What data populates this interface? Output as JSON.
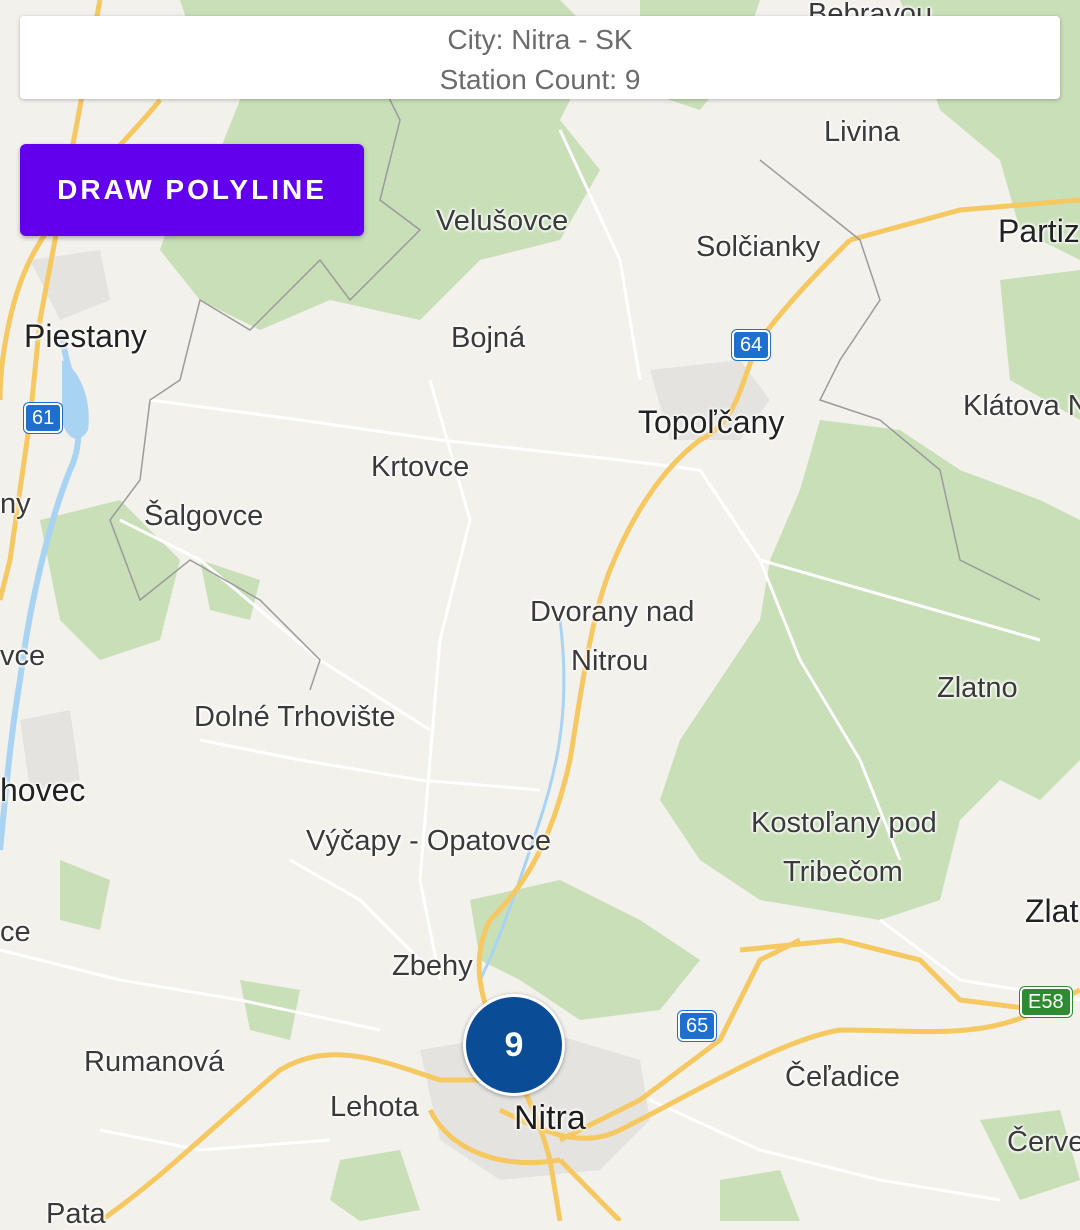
{
  "info_card": {
    "city_line": "City: Nitra - SK",
    "station_line": "Station Count: 9"
  },
  "toolbar": {
    "draw_polyline_label": "DRAW POLYLINE"
  },
  "cluster": {
    "count": "9",
    "color": "#0a4c95"
  },
  "map": {
    "places": [
      {
        "id": "bebravou",
        "name": "Bebravou"
      },
      {
        "id": "livina",
        "name": "Livina"
      },
      {
        "id": "velusovce",
        "name": "Velušovce"
      },
      {
        "id": "solcianky",
        "name": "Solčianky"
      },
      {
        "id": "partiz",
        "name": "Partiz"
      },
      {
        "id": "piestany",
        "name": "Piestany"
      },
      {
        "id": "bojna",
        "name": "Bojná"
      },
      {
        "id": "topolcany",
        "name": "Topoľčany"
      },
      {
        "id": "klatova",
        "name": "Klátova N"
      },
      {
        "id": "krtovce",
        "name": "Krtovce"
      },
      {
        "id": "ny",
        "name": "ny"
      },
      {
        "id": "salgovce",
        "name": "Šalgovce"
      },
      {
        "id": "dvorany1",
        "name": "Dvorany nad"
      },
      {
        "id": "dvorany2",
        "name": "Nitrou"
      },
      {
        "id": "vce",
        "name": "vce"
      },
      {
        "id": "zlatno",
        "name": "Zlatno"
      },
      {
        "id": "dolne",
        "name": "Dolné Trhovište"
      },
      {
        "id": "hovec",
        "name": "hovec"
      },
      {
        "id": "kostolany1",
        "name": "Kostoľany pod"
      },
      {
        "id": "kostolany2",
        "name": "Tribečom"
      },
      {
        "id": "vycapy",
        "name": "Výčapy - Opatovce"
      },
      {
        "id": "zlat",
        "name": "Zlat"
      },
      {
        "id": "ce",
        "name": "ce"
      },
      {
        "id": "zbehy",
        "name": "Zbehy"
      },
      {
        "id": "rumanova",
        "name": "Rumanová"
      },
      {
        "id": "celadice",
        "name": "Čeľadice"
      },
      {
        "id": "lehota",
        "name": "Lehota"
      },
      {
        "id": "nitra",
        "name": "Nitra"
      },
      {
        "id": "cerve",
        "name": "Červe"
      },
      {
        "id": "pata",
        "name": "Pata"
      }
    ],
    "road_shields": [
      {
        "id": "r64",
        "label": "64"
      },
      {
        "id": "r61",
        "label": "61"
      },
      {
        "id": "r65",
        "label": "65"
      },
      {
        "id": "e58",
        "label": "E58"
      }
    ],
    "colors": {
      "land": "#f3f1ec",
      "forest": "#c8dfb8",
      "road_major": "#f6c862",
      "road_minor": "#ffffff",
      "water": "#a9d3f2",
      "urban": "#e5e3df",
      "shield_national": "#1e6fd0",
      "shield_euro": "#2e8b32"
    }
  }
}
